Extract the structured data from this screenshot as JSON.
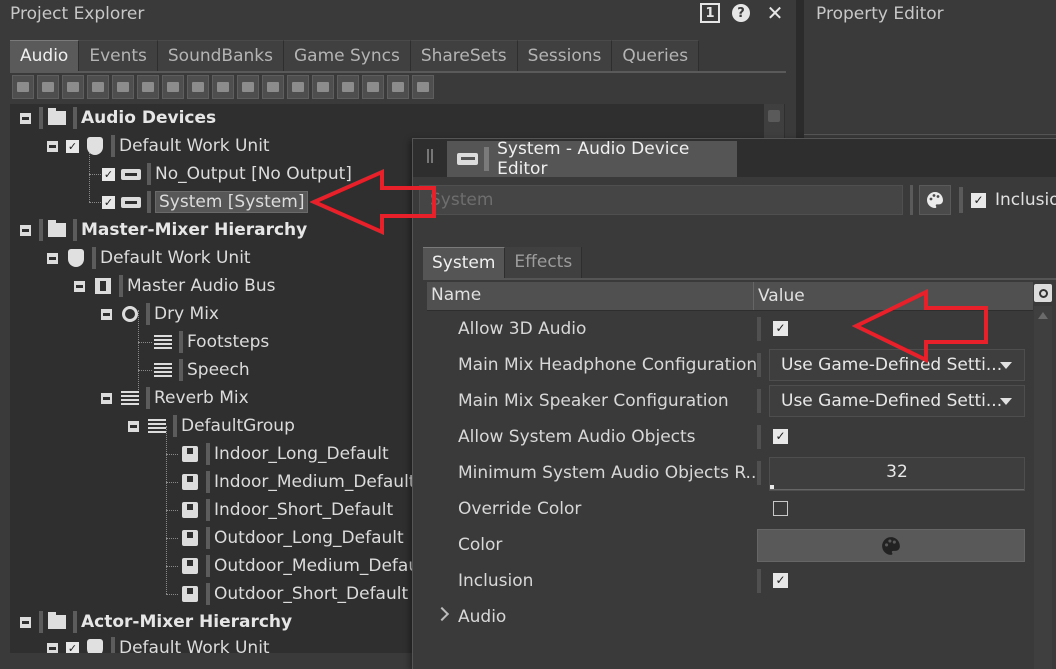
{
  "project_explorer": {
    "title": "Project Explorer",
    "badge": "1",
    "help": "?",
    "close": "✕",
    "tabs": [
      "Audio",
      "Events",
      "SoundBanks",
      "Game Syncs",
      "ShareSets",
      "Sessions",
      "Queries"
    ],
    "active_tab": "Audio",
    "tree": {
      "audio_devices": "Audio Devices",
      "dwu1": "Default Work Unit",
      "no_output": "No_Output [No Output]",
      "system": "System [System]",
      "master_mixer": "Master-Mixer Hierarchy",
      "dwu2": "Default Work Unit",
      "master_audio_bus": "Master Audio Bus",
      "dry_mix": "Dry Mix",
      "footsteps": "Footsteps",
      "speech": "Speech",
      "reverb_mix": "Reverb Mix",
      "default_group": "DefaultGroup",
      "indoor_long": "Indoor_Long_Default",
      "indoor_medium": "Indoor_Medium_Default",
      "indoor_short": "Indoor_Short_Default",
      "outdoor_long": "Outdoor_Long_Default",
      "outdoor_medium": "Outdoor_Medium_Default",
      "outdoor_short": "Outdoor_Short_Default",
      "actor_mixer": "Actor-Mixer Hierarchy",
      "dwu3": "Default Work Unit"
    }
  },
  "property_editor": {
    "title": "Property Editor"
  },
  "device_editor": {
    "title": "System - Audio Device Editor",
    "name_value": "System",
    "inclusion_label": "Inclusion",
    "tabs": [
      "System",
      "Effects"
    ],
    "columns": {
      "name": "Name",
      "value": "Value"
    },
    "props": {
      "allow3d": "Allow 3D Audio",
      "headphone": "Main Mix Headphone Configuration",
      "headphone_val": "Use Game-Defined Setti...",
      "speaker": "Main Mix Speaker Configuration",
      "speaker_val": "Use Game-Defined Setti...",
      "sys_objects": "Allow System Audio Objects",
      "min_objects": "Minimum System Audio Objects R...",
      "min_objects_val": "32",
      "override_color": "Override Color",
      "color": "Color",
      "inclusion": "Inclusion",
      "audio": "Audio"
    }
  },
  "colors": {
    "annotation": "#e8202a",
    "background": "#3a3a3a"
  }
}
